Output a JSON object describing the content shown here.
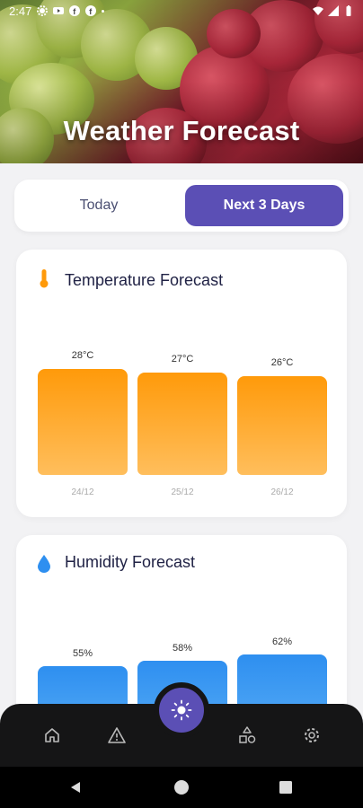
{
  "status_bar": {
    "time": "2:47"
  },
  "header": {
    "title": "Weather Forecast"
  },
  "tabs": [
    {
      "label": "Today",
      "active": false
    },
    {
      "label": "Next 3 Days",
      "active": true
    }
  ],
  "temperature": {
    "title": "Temperature Forecast",
    "icon": "thermometer-icon",
    "days": [
      {
        "date": "24/12",
        "value": "28°C",
        "temp": 28
      },
      {
        "date": "25/12",
        "value": "27°C",
        "temp": 27
      },
      {
        "date": "26/12",
        "value": "26°C",
        "temp": 26
      }
    ]
  },
  "humidity": {
    "title": "Humidity Forecast",
    "icon": "water-drop-icon",
    "days": [
      {
        "value": "55%",
        "humidity": 55
      },
      {
        "value": "58%",
        "humidity": 58
      },
      {
        "value": "62%",
        "humidity": 62
      }
    ]
  },
  "bottom_nav": {
    "items": [
      "home-icon",
      "warning-icon",
      "shapes-icon",
      "gear-icon"
    ],
    "fab_icon": "sun-icon"
  },
  "colors": {
    "accent": "#5b4fb5",
    "temperature_bar": "#ff9a0a",
    "humidity_bar": "#2e8ff0"
  }
}
